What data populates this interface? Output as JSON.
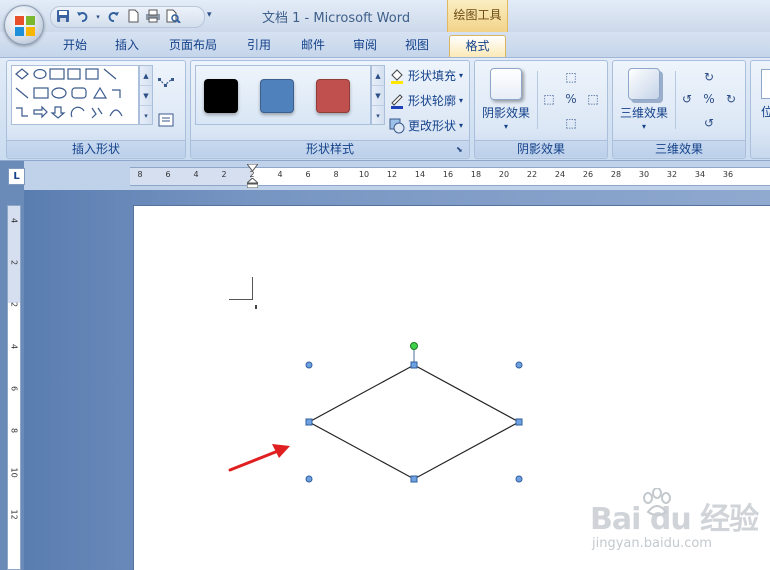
{
  "window": {
    "title": "文档 1 - Microsoft Word",
    "context_tab_header": "绘图工具"
  },
  "tabs": [
    {
      "label": "开始"
    },
    {
      "label": "插入"
    },
    {
      "label": "页面布局"
    },
    {
      "label": "引用"
    },
    {
      "label": "邮件"
    },
    {
      "label": "审阅"
    },
    {
      "label": "视图"
    },
    {
      "label": "格式",
      "active": true
    }
  ],
  "ribbon": {
    "groups": {
      "insert_shapes": "插入形状",
      "shape_styles": "形状样式",
      "shadow_effects": "阴影效果",
      "threed_effects": "三维效果"
    },
    "shape_fill": "形状填充",
    "shape_outline": "形状轮廓",
    "change_shape": "更改形状",
    "shadow_button": "阴影效果",
    "threed_button": "三维效果",
    "partial_label": "位",
    "swatch_colors": [
      "#000000",
      "#4f81bd",
      "#c0504d"
    ]
  },
  "ruler": {
    "corner_label": "L",
    "h_ticks": [
      "8",
      "6",
      "4",
      "2",
      "2",
      "4",
      "6",
      "8",
      "10",
      "12",
      "14",
      "16",
      "18",
      "20",
      "22",
      "24",
      "26",
      "28",
      "30",
      "32",
      "34",
      "36"
    ],
    "v_ticks": [
      "4",
      "2",
      "2",
      "4",
      "6",
      "8",
      "10",
      "12"
    ]
  },
  "watermark": {
    "brand": "Bai du 经验",
    "url": "jingyan.baidu.com"
  }
}
